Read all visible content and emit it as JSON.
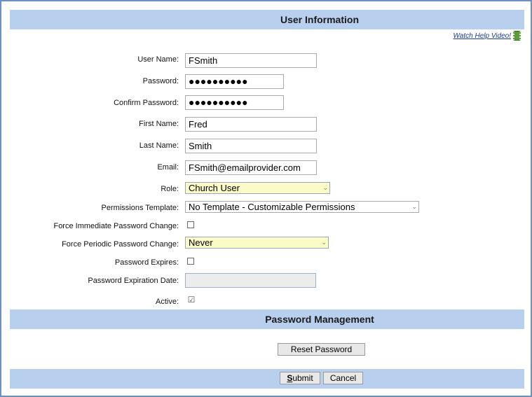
{
  "header": {
    "title": "User Information"
  },
  "help_link": {
    "label": "Watch Help Video!",
    "icon": "film-icon"
  },
  "form": {
    "username": {
      "label": "User Name:",
      "value": "FSmith"
    },
    "password": {
      "label": "Password:",
      "value": "●●●●●●●●●●"
    },
    "confirm_password": {
      "label": "Confirm Password:",
      "value": "●●●●●●●●●●"
    },
    "first_name": {
      "label": "First Name:",
      "value": "Fred"
    },
    "last_name": {
      "label": "Last Name:",
      "value": "Smith"
    },
    "email": {
      "label": "Email:",
      "value": "FSmith@emailprovider.com"
    },
    "role": {
      "label": "Role:",
      "selected": "Church User"
    },
    "permissions_template": {
      "label": "Permissions Template:",
      "selected": "No Template - Customizable Permissions"
    },
    "force_immediate": {
      "label": "Force Immediate Password Change:",
      "checked": false
    },
    "force_periodic": {
      "label": "Force Periodic Password Change:",
      "selected": "Never"
    },
    "password_expires": {
      "label": "Password Expires:",
      "checked": false
    },
    "expiration_date": {
      "label": "Password Expiration Date:",
      "value": ""
    },
    "active": {
      "label": "Active:",
      "checked": true,
      "check_glyph": "☑"
    }
  },
  "password_management": {
    "title": "Password Management",
    "reset_label": "Reset Password"
  },
  "footer": {
    "submit_key": "S",
    "submit_rest": "ubmit",
    "cancel_label": "Cancel"
  },
  "colors": {
    "band": "#b9cfee",
    "frame_border": "#6d8fc4",
    "select_highlight": "#fbfbc8"
  }
}
